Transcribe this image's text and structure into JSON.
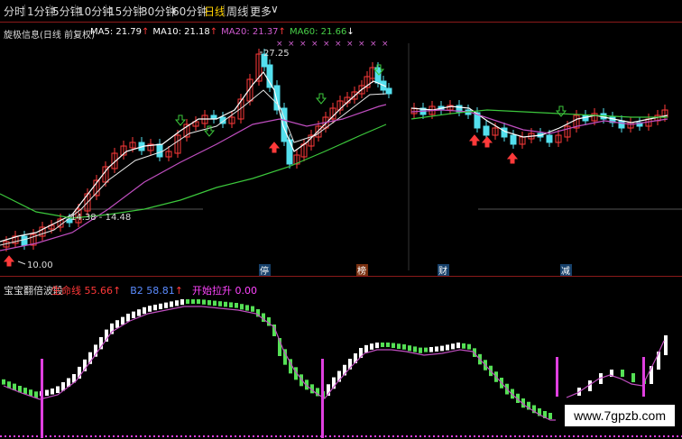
{
  "toolbar": {
    "tabs": [
      {
        "label": "分时",
        "active": false
      },
      {
        "label": "1分钟",
        "active": false
      },
      {
        "label": "5分钟",
        "active": false
      },
      {
        "label": "10分钟",
        "active": false
      },
      {
        "label": "15分钟",
        "active": false
      },
      {
        "label": "30分钟",
        "active": false
      },
      {
        "label": "60分钟",
        "active": false
      },
      {
        "label": "日线",
        "active": true
      },
      {
        "label": "周线",
        "active": false
      },
      {
        "label": "更多",
        "active": false
      }
    ],
    "more_icon": "chevron-down-icon"
  },
  "main_chart": {
    "title": "旋极信息(日线 前复权)",
    "ma": [
      {
        "label": "MA5: 21.79",
        "arrow": "↑",
        "color": "#ffffff"
      },
      {
        "label": "MA10: 21.18",
        "arrow": "↑",
        "color": "#ffffff"
      },
      {
        "label": "MA20: 21.37",
        "arrow": "↑",
        "color": "#d25bd2"
      },
      {
        "label": "MA60: 21.66",
        "arrow": "↓",
        "color": "#48d048"
      }
    ],
    "price_high": "27.25",
    "price_low": "10.00",
    "range_label": "14.38 - 14.48",
    "event_markers": [
      "停",
      "榜",
      "财",
      "减"
    ]
  },
  "indicator": {
    "title": "宝宝翻倍波段",
    "items": [
      {
        "name": "生命线",
        "value": "55.66",
        "arrow": "↑",
        "color": "#ff3838"
      },
      {
        "name": "B2",
        "value": "58.81",
        "arrow": "↑",
        "color": "#5b8cff"
      },
      {
        "name": "开始拉升",
        "value": "0.00",
        "arrow": "",
        "color": "#ff44ff"
      }
    ]
  },
  "watermark": "www.7gpzb.com",
  "colors": {
    "up": "#ff3a3a",
    "down": "#54e0ee",
    "ma_white": "#ffffff",
    "ma_purple": "#c04ec0",
    "ma_green": "#3cc83c",
    "osc_up": "#ffffff",
    "osc_down": "#55e055",
    "signal": "#e040e0"
  }
}
